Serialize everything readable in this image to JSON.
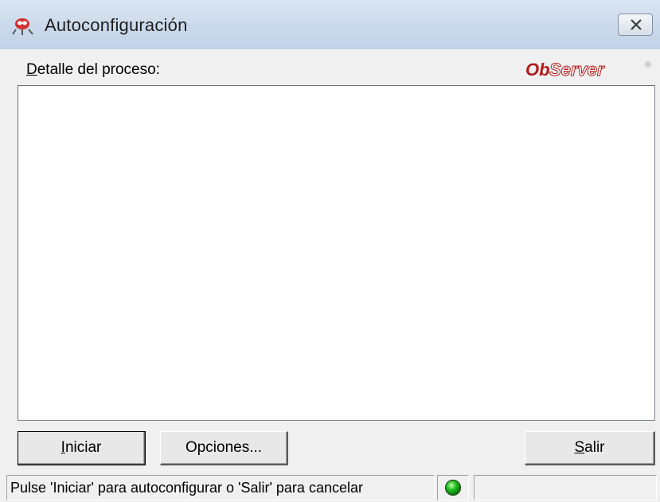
{
  "window": {
    "title": "Autoconfiguración",
    "close_glyph": "close-icon"
  },
  "detalle": {
    "label_mnemonic": "D",
    "label_rest": "etalle del proceso:"
  },
  "logo": {
    "text_bold": "Ob",
    "text_rest": "Server",
    "registered": "®",
    "color": "#b31a1a"
  },
  "log": {
    "content": ""
  },
  "buttons": {
    "iniciar": {
      "mnemonic": "I",
      "rest": "niciar"
    },
    "opciones": {
      "label": "Opciones..."
    },
    "salir": {
      "mnemonic": "S",
      "rest": "alir"
    }
  },
  "statusbar": {
    "message": "Pulse 'Iniciar' para autoconfigurar o 'Salir' para cancelar",
    "led_color": "#22c322",
    "extra": ""
  }
}
